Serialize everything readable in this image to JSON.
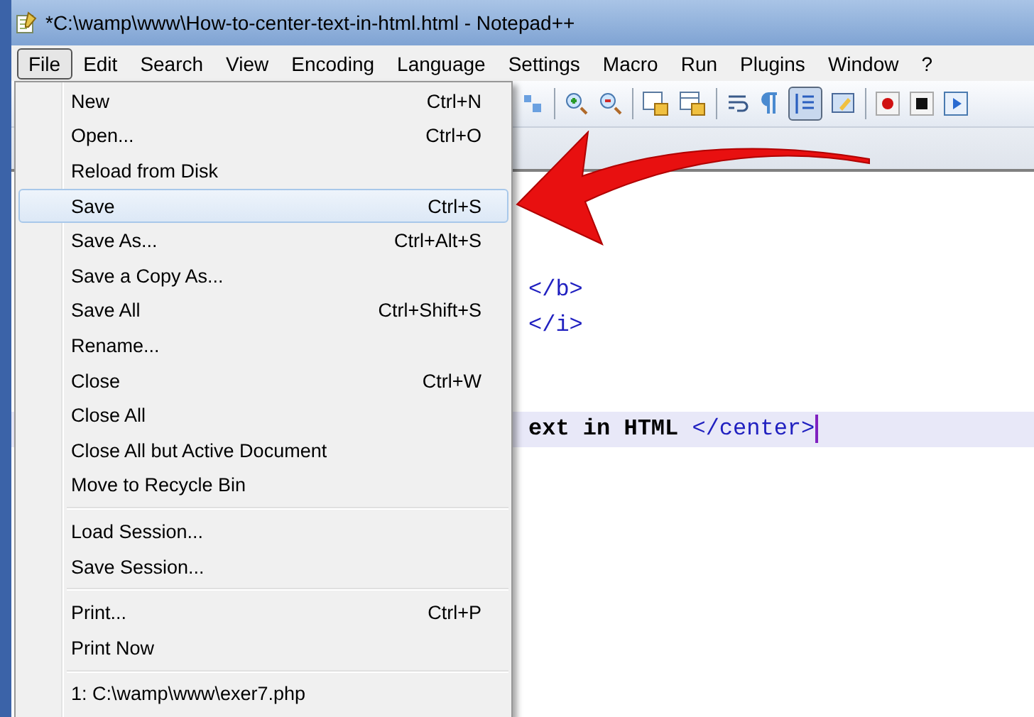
{
  "window": {
    "title": "*C:\\wamp\\www\\How-to-center-text-in-html.html - Notepad++"
  },
  "menubar": [
    {
      "label": "File",
      "selected": true
    },
    {
      "label": "Edit",
      "selected": false
    },
    {
      "label": "Search",
      "selected": false
    },
    {
      "label": "View",
      "selected": false
    },
    {
      "label": "Encoding",
      "selected": false
    },
    {
      "label": "Language",
      "selected": false
    },
    {
      "label": "Settings",
      "selected": false
    },
    {
      "label": "Macro",
      "selected": false
    },
    {
      "label": "Run",
      "selected": false
    },
    {
      "label": "Plugins",
      "selected": false
    },
    {
      "label": "Window",
      "selected": false
    },
    {
      "label": "?",
      "selected": false
    }
  ],
  "file_menu": [
    [
      {
        "label": "New",
        "shortcut": "Ctrl+N",
        "selected": false
      },
      {
        "label": "Open...",
        "shortcut": "Ctrl+O",
        "selected": false
      },
      {
        "label": "Reload from Disk",
        "selected": false
      },
      {
        "label": "Save",
        "shortcut": "Ctrl+S",
        "selected": true
      },
      {
        "label": "Save As...",
        "shortcut": "Ctrl+Alt+S",
        "selected": false
      },
      {
        "label": "Save a Copy As...",
        "selected": false
      },
      {
        "label": "Save All",
        "shortcut": "Ctrl+Shift+S",
        "selected": false
      },
      {
        "label": "Rename...",
        "selected": false
      },
      {
        "label": "Close",
        "shortcut": "Ctrl+W",
        "selected": false
      },
      {
        "label": "Close All",
        "selected": false
      },
      {
        "label": "Close All but Active Document",
        "selected": false
      },
      {
        "label": "Move to Recycle Bin",
        "selected": false
      }
    ],
    [
      {
        "label": "Load Session...",
        "selected": false
      },
      {
        "label": "Save Session...",
        "selected": false
      }
    ],
    [
      {
        "label": "Print...",
        "shortcut": "Ctrl+P",
        "selected": false
      },
      {
        "label": "Print Now",
        "selected": false
      }
    ],
    [
      {
        "label": "1: C:\\wamp\\www\\exer7.php",
        "selected": false
      }
    ]
  ],
  "editor": {
    "lines": [
      {
        "current": false,
        "segments": [
          {
            "kind": "tag",
            "text": "</b>"
          }
        ]
      },
      {
        "current": false,
        "segments": [
          {
            "kind": "tag",
            "text": "</i>"
          }
        ]
      },
      {
        "current": true,
        "segments": [
          {
            "kind": "text",
            "text": "ext in HTML "
          },
          {
            "kind": "tag",
            "text": "</center>"
          }
        ]
      }
    ]
  }
}
